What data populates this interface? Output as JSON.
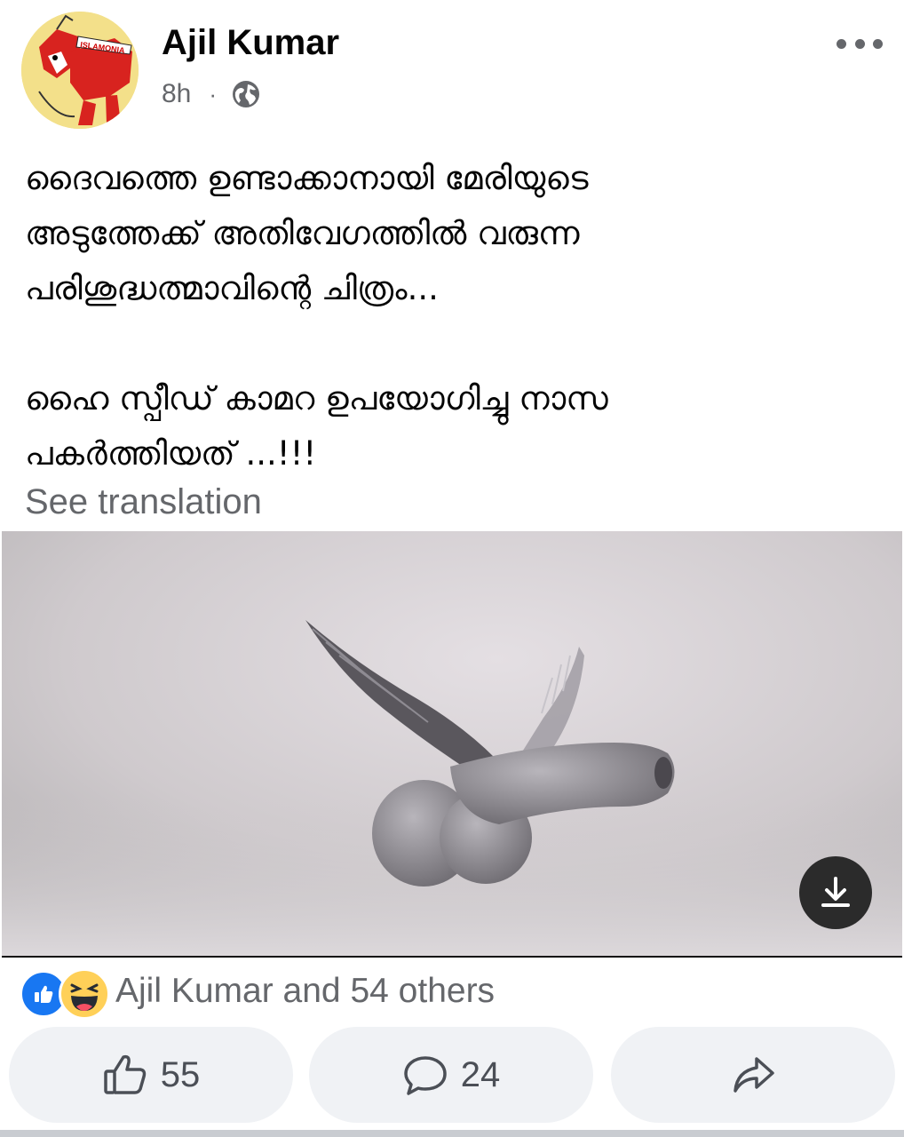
{
  "post": {
    "author": "Ajil Kumar",
    "avatar_label": "ISLAMONIA",
    "time": "8h",
    "separator": "·",
    "privacy_icon": "globe-icon",
    "more_icon": "more-options-icon",
    "text_paragraph_1": [
      "ദൈവത്തെ ഉണ്ടാക്കാനായി മേരിയുടെ",
      "അടുത്തേക്ക് അതിവേഗത്തിൽ വരുന്ന",
      "പരിശുദ്ധത്മാവിന്റെ ചിത്രം..."
    ],
    "text_paragraph_2": [
      "ഹൈ സ്പീഡ് കാമറ ഉപയോഗിച്ചു നാസ",
      "പകർത്തിയത് ...!!!"
    ],
    "see_translation": "See translation",
    "download_icon": "download-icon"
  },
  "reactions": {
    "icons": [
      "like-icon",
      "haha-icon"
    ],
    "summary": "Ajil Kumar and 54 others"
  },
  "actions": {
    "like": {
      "icon": "thumbs-up-icon",
      "count": "55"
    },
    "comment": {
      "icon": "comment-icon",
      "count": "24"
    },
    "share": {
      "icon": "share-icon"
    }
  },
  "colors": {
    "secondary_text": "#65676b",
    "button_bg": "#f0f2f5",
    "like_blue": "#1877f2",
    "haha_yellow": "#ffd058"
  }
}
